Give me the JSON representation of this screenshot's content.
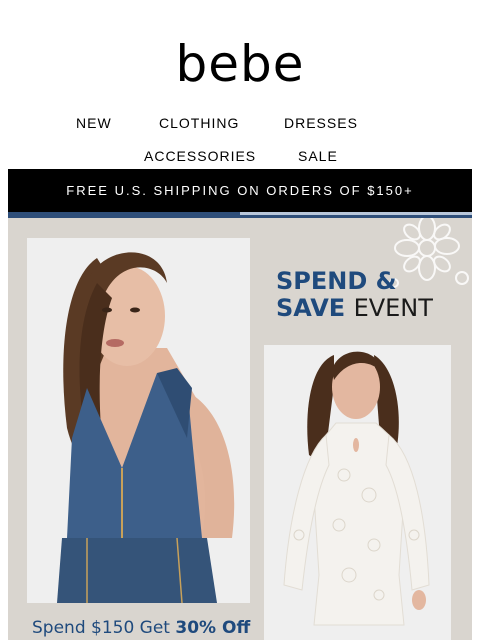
{
  "brand": {
    "logo_text": "bebe"
  },
  "nav": {
    "items": [
      "NEW",
      "CLOTHING",
      "DRESSES",
      "ACCESSORIES",
      "SALE"
    ]
  },
  "banner": {
    "text": "FREE U.S. SHIPPING ON ORDERS OF $150+"
  },
  "promo": {
    "headline_line1": "SPEND &",
    "headline_line2_bold": "SAVE",
    "headline_line2_light": "EVENT",
    "offer_prefix": "Spend $150 Get",
    "offer_bold": "30% Off"
  },
  "colors": {
    "navy": "#1f4a7d",
    "banner_bg": "#000000",
    "promo_bg": "#d9d5cf",
    "denim": "#3d5f8a",
    "lace_dress": "#f4f2ee"
  }
}
